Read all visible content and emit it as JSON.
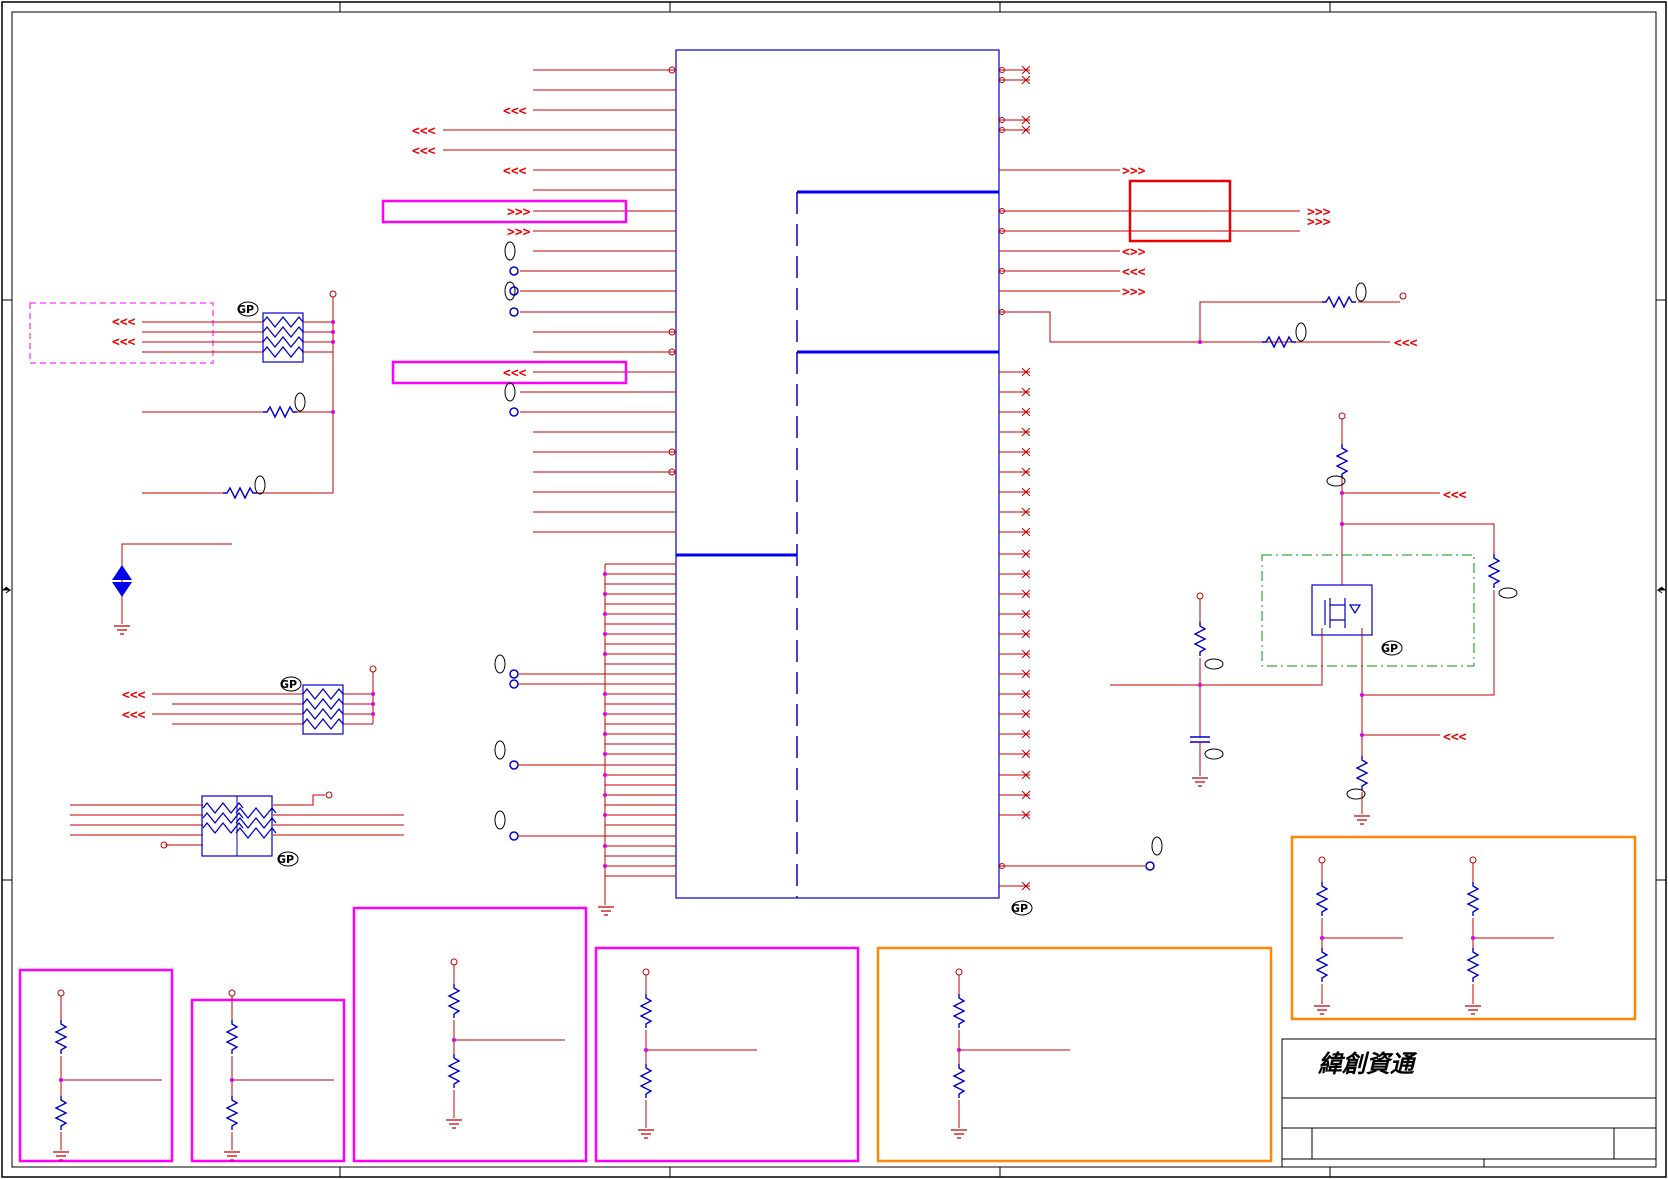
{
  "title_block": {
    "company": "緯創資通"
  },
  "symbols": {
    "part_tag": "GP",
    "left_arrows": "<<<",
    "right_arrows": ">>>",
    "mixed_arrows": "<>>"
  },
  "colors": {
    "wire": "#c00000",
    "component": "#0000cc",
    "pin_dot": "#e000e0",
    "highlight_magenta": "#ff00ff",
    "highlight_orange": "#ff8800",
    "highlight_red": "#ee0000",
    "highlight_green": "#009900",
    "frame": "#000000"
  }
}
